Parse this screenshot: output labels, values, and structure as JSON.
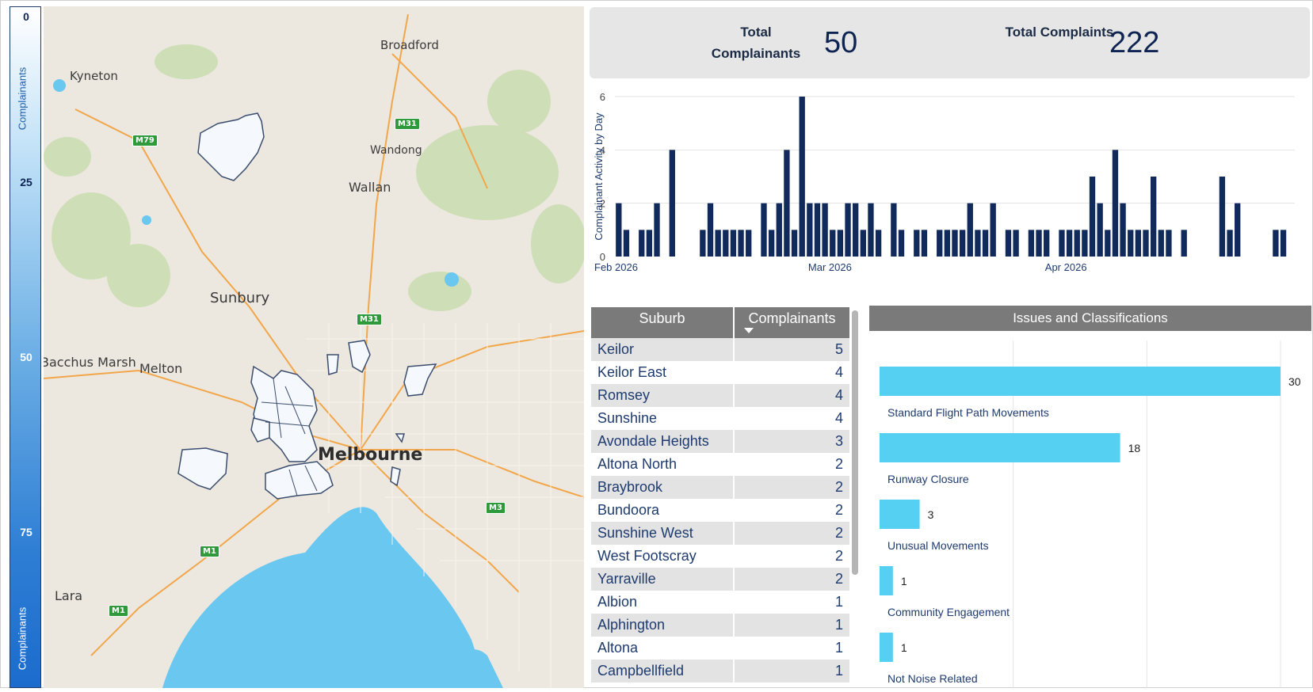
{
  "legend": {
    "ticks": [
      "0",
      "25",
      "50",
      "75"
    ],
    "label_top": "Complainants",
    "label_bottom": "Complainants"
  },
  "map": {
    "places": [
      "Broadford",
      "Kyneton",
      "Wandong",
      "Wallan",
      "Sunbury",
      "Bacchus Marsh",
      "Melton",
      "Melbourne",
      "Lara"
    ],
    "shields": [
      "M79",
      "M31",
      "M31",
      "M3",
      "M1",
      "M1"
    ],
    "colors": {
      "land": "#ece8e0",
      "water": "#6ac7ef",
      "green": "#c9ddb0",
      "road": "#f2a64a",
      "region_fill": "#f5f8fc",
      "region_stroke": "#3b4d6e"
    }
  },
  "kpi": {
    "complainants_label": "Total Complainants",
    "complainants_value": "50",
    "complaints_label": "Total Complaints",
    "complaints_value": "222"
  },
  "chart_data": [
    {
      "type": "bar",
      "ylabel": "Complainant Activity by Day",
      "xlabel": "",
      "ylim": [
        0,
        6
      ],
      "yticks": [
        0,
        2,
        4,
        6
      ],
      "xticks": [
        "Feb 2026",
        "Mar 2026",
        "Apr 2026"
      ],
      "x_range": [
        "2026-02-01",
        "2026-05-01"
      ],
      "grid": true,
      "color": "#102a5c",
      "dates": [
        "2026-02-01",
        "2026-02-02",
        "2026-02-04",
        "2026-02-05",
        "2026-02-06",
        "2026-02-08",
        "2026-02-12",
        "2026-02-13",
        "2026-02-14",
        "2026-02-15",
        "2026-02-16",
        "2026-02-17",
        "2026-02-18",
        "2026-02-20",
        "2026-02-21",
        "2026-02-22",
        "2026-02-23",
        "2026-02-24",
        "2026-02-25",
        "2026-02-26",
        "2026-02-27",
        "2026-02-28",
        "2026-03-01",
        "2026-03-02",
        "2026-03-03",
        "2026-03-04",
        "2026-03-05",
        "2026-03-06",
        "2026-03-07",
        "2026-03-09",
        "2026-03-10",
        "2026-03-12",
        "2026-03-13",
        "2026-03-15",
        "2026-03-16",
        "2026-03-17",
        "2026-03-18",
        "2026-03-19",
        "2026-03-20",
        "2026-03-21",
        "2026-03-22",
        "2026-03-24",
        "2026-03-25",
        "2026-03-27",
        "2026-03-28",
        "2026-03-29",
        "2026-03-31",
        "2026-04-01",
        "2026-04-02",
        "2026-04-03",
        "2026-04-04",
        "2026-04-05",
        "2026-04-06",
        "2026-04-07",
        "2026-04-08",
        "2026-04-09",
        "2026-04-10",
        "2026-04-11",
        "2026-04-12",
        "2026-04-13",
        "2026-04-14",
        "2026-04-16",
        "2026-04-21",
        "2026-04-22",
        "2026-04-23",
        "2026-04-28",
        "2026-04-29"
      ],
      "values": [
        2,
        1,
        1,
        1,
        2,
        4,
        1,
        2,
        1,
        1,
        1,
        1,
        1,
        2,
        1,
        2,
        4,
        1,
        6,
        2,
        2,
        2,
        1,
        1,
        2,
        2,
        1,
        2,
        1,
        2,
        1,
        1,
        1,
        1,
        1,
        1,
        1,
        2,
        1,
        1,
        2,
        1,
        1,
        1,
        1,
        1,
        1,
        1,
        1,
        1,
        3,
        2,
        1,
        4,
        2,
        1,
        1,
        1,
        3,
        1,
        1,
        1,
        3,
        1,
        2,
        1,
        1
      ]
    },
    {
      "type": "bar",
      "orientation": "horizontal",
      "title": "Issues and Classifications",
      "categories": [
        "Standard Flight Path Movements",
        "Runway Closure",
        "Unusual Movements",
        "Community Engagement",
        "Not Noise Related"
      ],
      "values": [
        30,
        18,
        3,
        1,
        1
      ],
      "xlim": [
        0,
        30
      ],
      "grid": true,
      "color": "#56d0f2"
    }
  ],
  "table": {
    "headers": [
      "Suburb",
      "Complainants"
    ],
    "rows": [
      [
        "Keilor",
        "5"
      ],
      [
        "Keilor East",
        "4"
      ],
      [
        "Romsey",
        "4"
      ],
      [
        "Sunshine",
        "4"
      ],
      [
        "Avondale Heights",
        "3"
      ],
      [
        "Altona North",
        "2"
      ],
      [
        "Braybrook",
        "2"
      ],
      [
        "Bundoora",
        "2"
      ],
      [
        "Sunshine West",
        "2"
      ],
      [
        "West Footscray",
        "2"
      ],
      [
        "Yarraville",
        "2"
      ],
      [
        "Albion",
        "1"
      ],
      [
        "Alphington",
        "1"
      ],
      [
        "Altona",
        "1"
      ],
      [
        "Campbellfield",
        "1"
      ]
    ]
  },
  "issues": {
    "title": "Issues and Classifications"
  }
}
